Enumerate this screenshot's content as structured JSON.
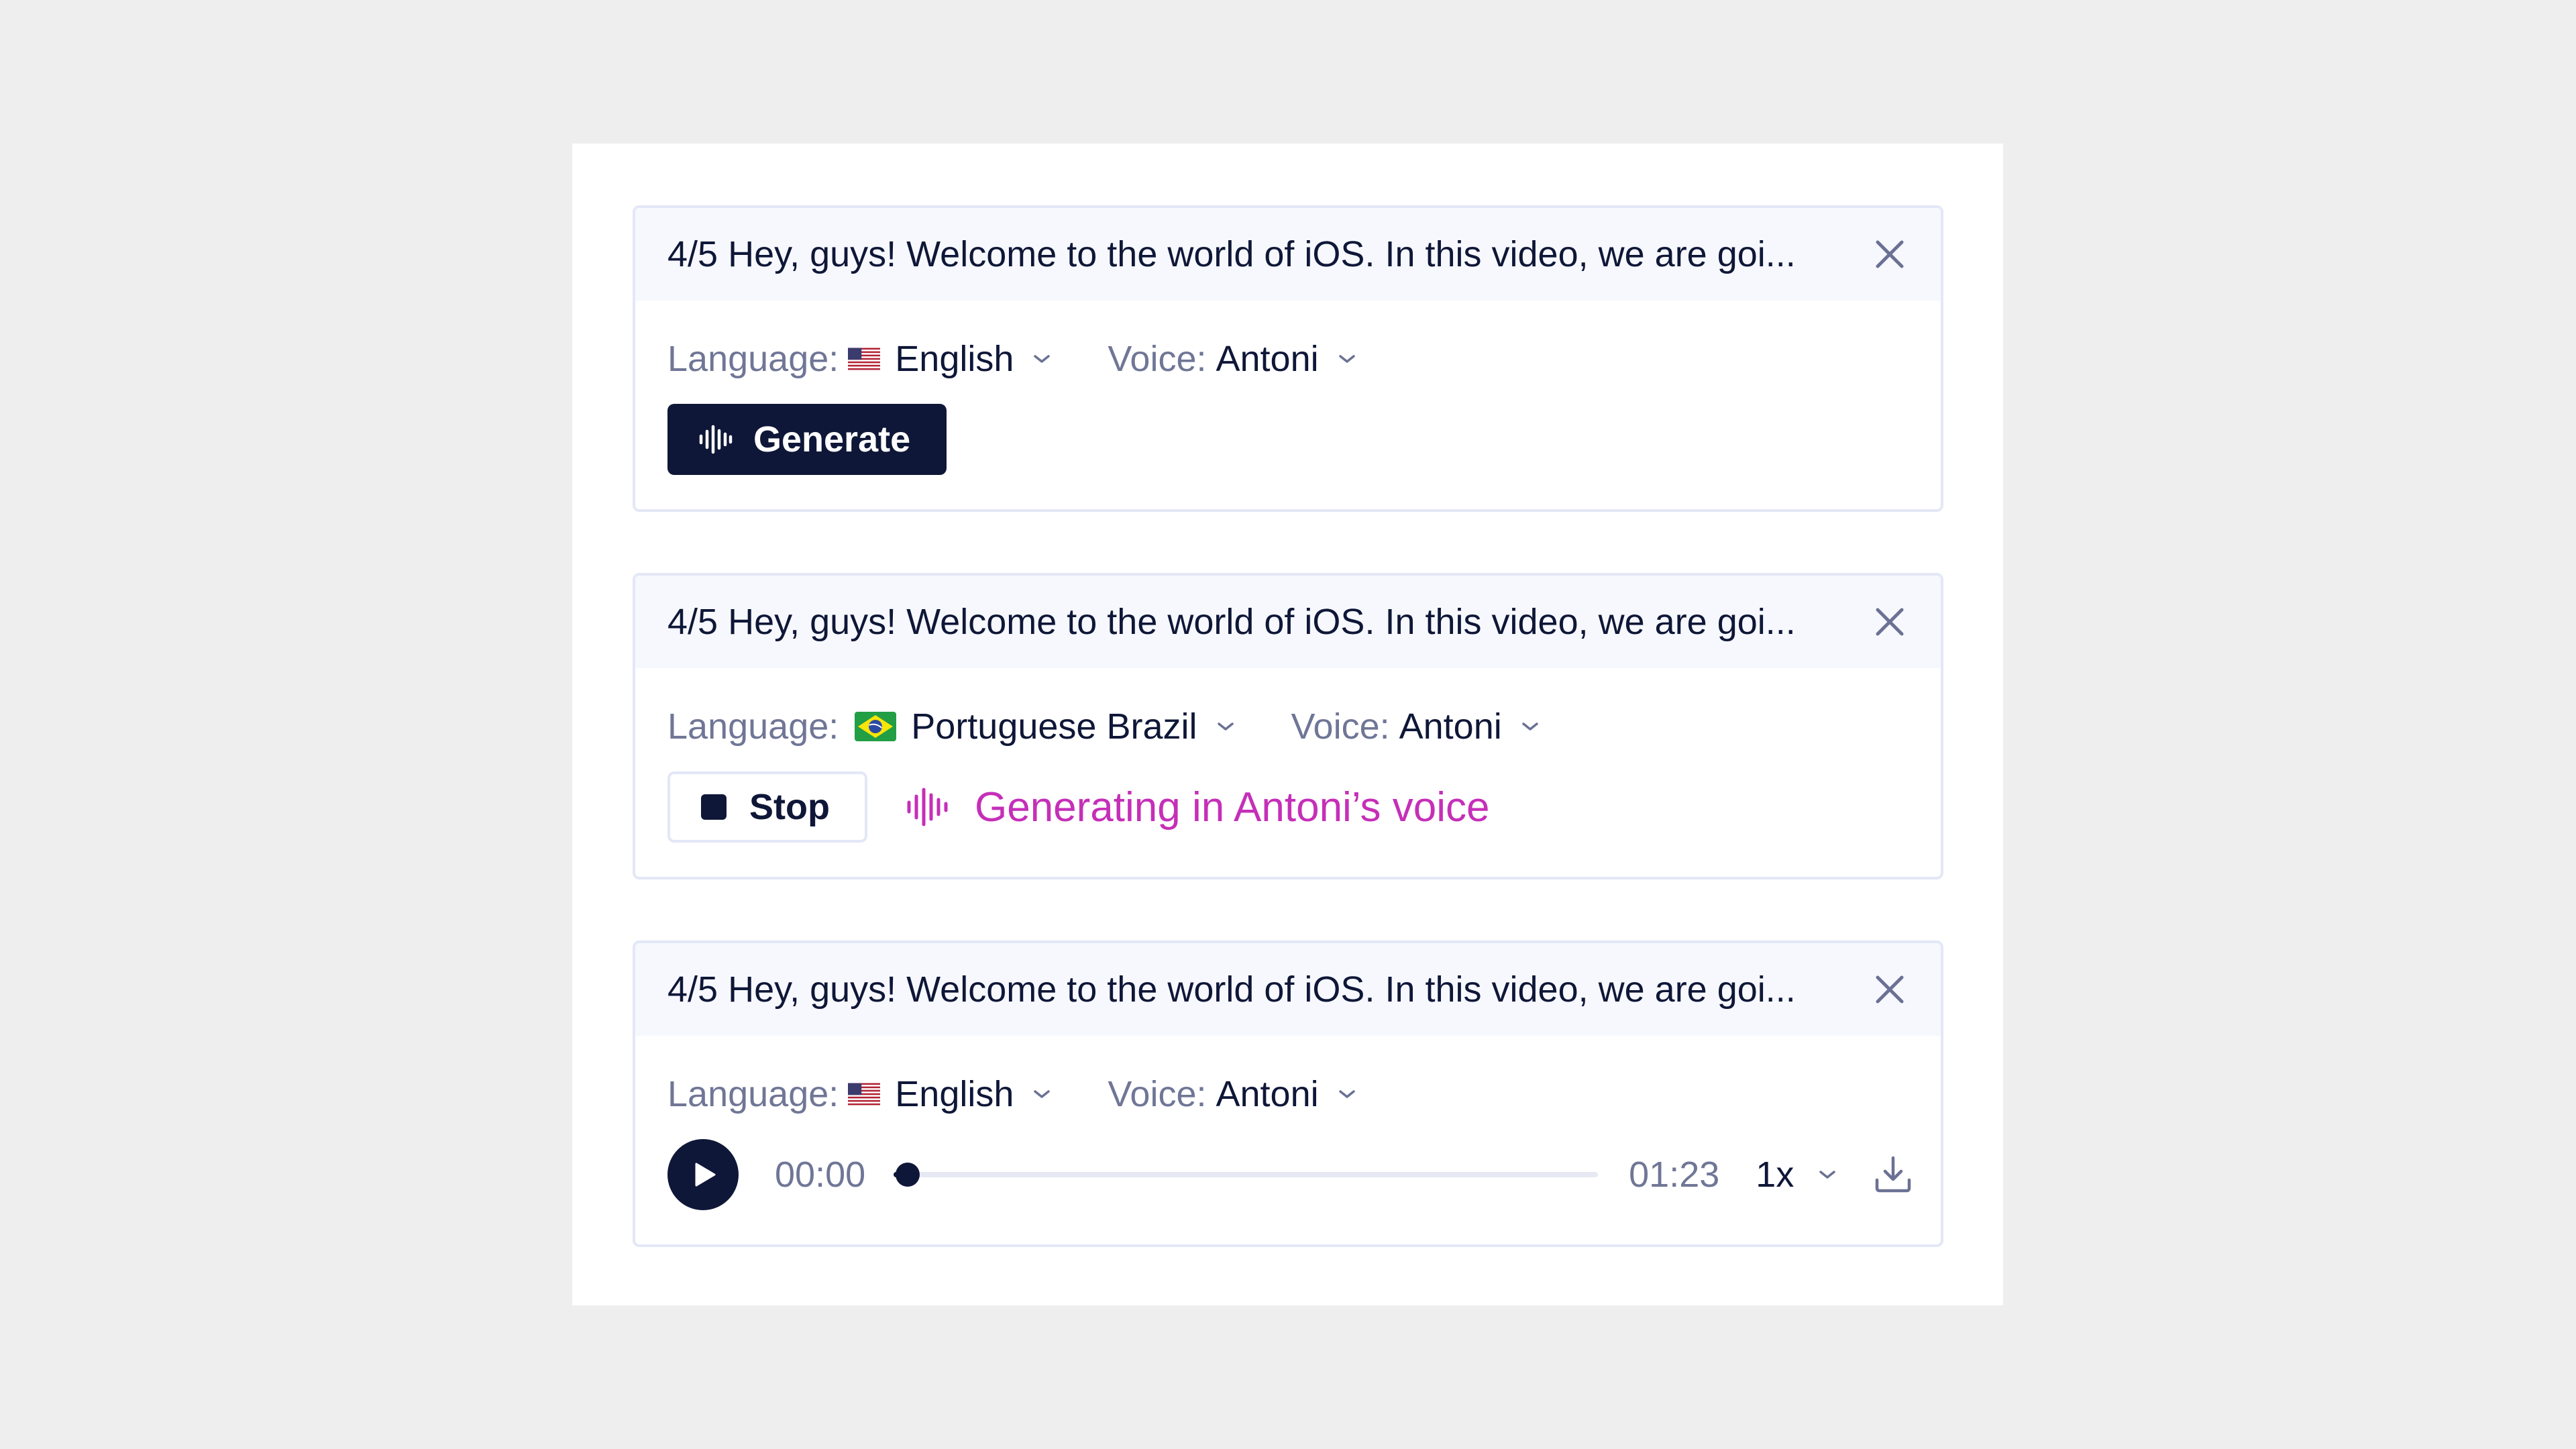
{
  "cards": [
    {
      "title": "4/5 Hey, guys! Welcome to the world of iOS. In this video, we are goi...",
      "language_label": "Language:",
      "language_value": "English",
      "language_flag": "us-flag-icon",
      "voice_label": "Voice:",
      "voice_value": "Antoni",
      "generate_label": "Generate"
    },
    {
      "title": "4/5 Hey, guys! Welcome to the world of iOS. In this video, we are goi...",
      "language_label": "Language:",
      "language_value": "Portuguese Brazil",
      "language_flag": "brazil-flag-icon",
      "voice_label": "Voice:",
      "voice_value": "Antoni",
      "stop_label": "Stop",
      "status_text": "Generating in Antoni’s voice"
    },
    {
      "title": "4/5 Hey, guys! Welcome to the world of iOS. In this video, we are goi...",
      "language_label": "Language:",
      "language_value": "English",
      "language_flag": "us-flag-icon",
      "voice_label": "Voice:",
      "voice_value": "Antoni",
      "player": {
        "current_time": "00:00",
        "duration": "01:23",
        "progress": 0.02,
        "speed": "1x"
      }
    }
  ],
  "colors": {
    "primary": "#0f1738",
    "muted": "#707696",
    "accent": "#c52fb8",
    "border": "#e3e7f6",
    "header_bg": "#f7f8fd"
  }
}
